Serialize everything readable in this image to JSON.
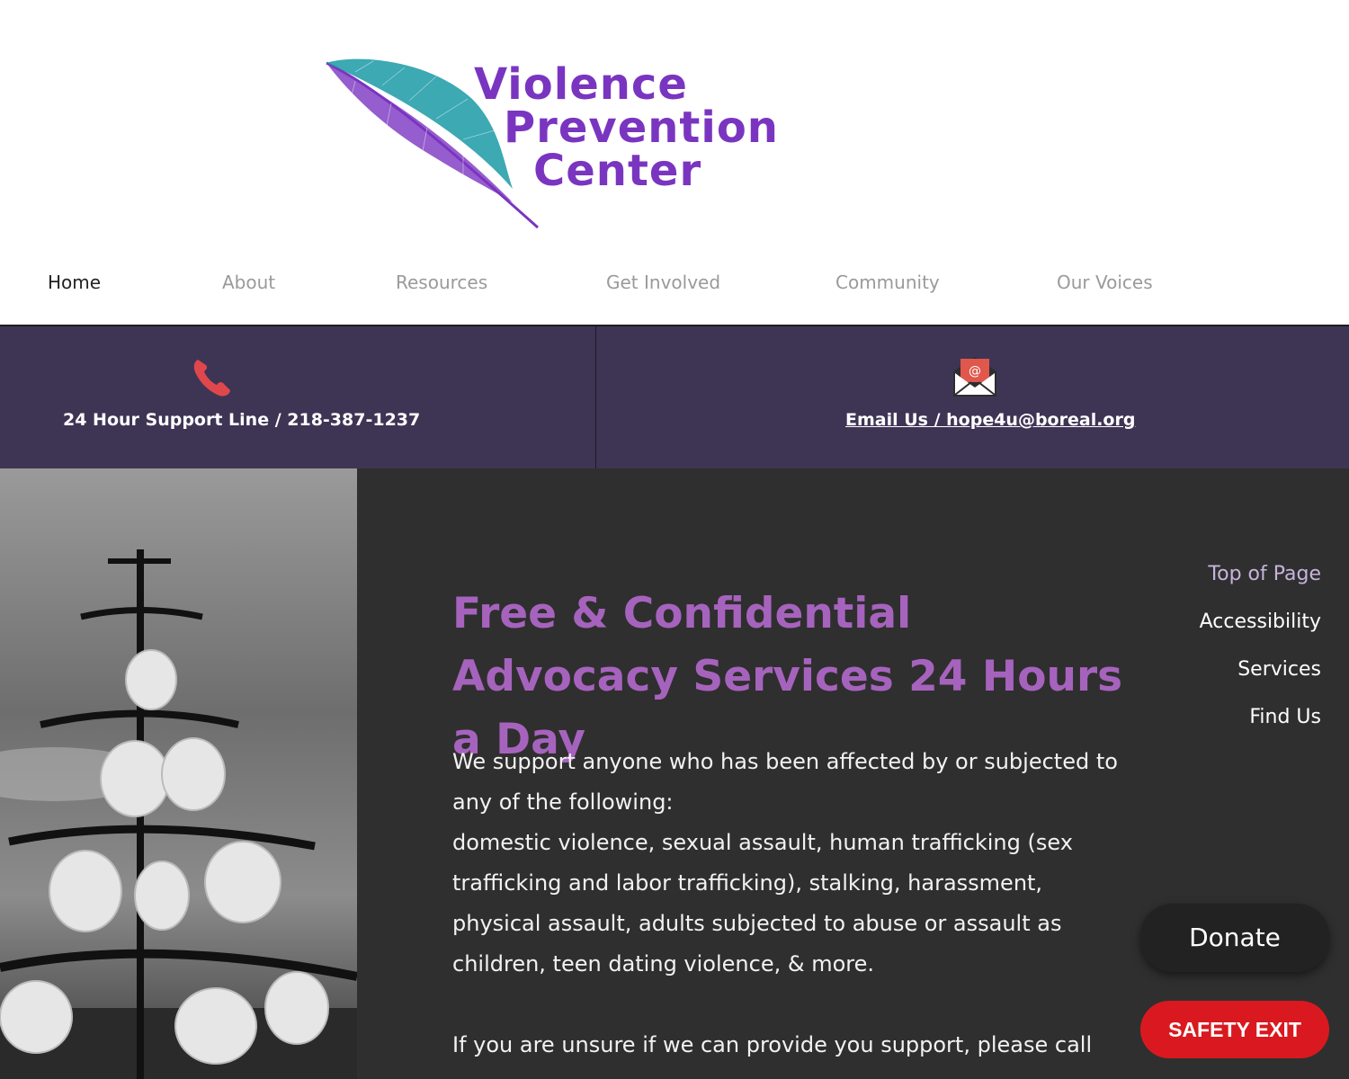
{
  "logo": {
    "line1": "Violence",
    "line2": "Prevention",
    "line3": "Center"
  },
  "nav": [
    {
      "label": "Home",
      "active": true
    },
    {
      "label": "About",
      "active": false
    },
    {
      "label": "Resources",
      "active": false
    },
    {
      "label": "Get Involved",
      "active": false
    },
    {
      "label": "Community",
      "active": false
    },
    {
      "label": "Our Voices",
      "active": false
    }
  ],
  "contact": {
    "phone": {
      "icon": "phone-icon",
      "text": "24 Hour Support Line / 218-387-1237"
    },
    "email": {
      "icon": "envelope-icon",
      "text": "Email Us / hope4u@boreal.org"
    }
  },
  "main": {
    "headline": "Free & Confidential Advocacy Services 24 Hours a Day",
    "paragraph1": "We support anyone who has been affected by or subjected to any of the following:",
    "paragraph1b": "domestic violence, sexual assault, human trafficking (sex trafficking and labor trafficking), stalking, harassment, physical assault, adults subjected to abuse or assault as children, teen dating violence, & more.",
    "paragraph2": "If you are unsure if we can provide you support, please call"
  },
  "side_nav": [
    "Top of Page",
    "Accessibility",
    "Services",
    "Find Us"
  ],
  "buttons": {
    "donate": "Donate",
    "safety_exit": "SAFETY EXIT"
  },
  "colors": {
    "brand_purple": "#7a35c0",
    "brand_teal": "#1a9aa6",
    "headline_purple": "#a663bd",
    "band_bg": "#3e3555",
    "content_bg": "#2f2f2f",
    "safety_red": "#d9191f"
  }
}
